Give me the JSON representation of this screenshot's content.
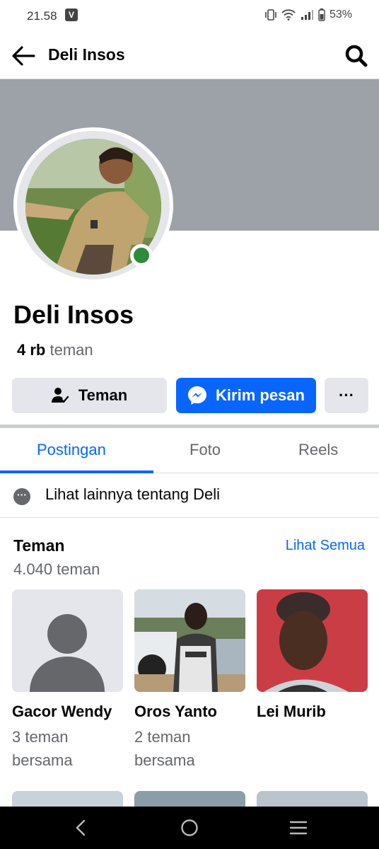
{
  "status_bar": {
    "time": "21.58",
    "v_badge": "V",
    "battery": "53%"
  },
  "header": {
    "title": "Deli Insos",
    "back_icon": "arrow-left-icon",
    "search_icon": "search-icon"
  },
  "profile": {
    "name": "Deli Insos",
    "friends_count_value": "4 rb",
    "friends_count_label": "teman",
    "online": true
  },
  "actions": {
    "friends_label": "Teman",
    "message_label": "Kirim pesan",
    "more_label": "···"
  },
  "tabs": [
    {
      "label": "Postingan",
      "active": true
    },
    {
      "label": "Foto",
      "active": false
    },
    {
      "label": "Reels",
      "active": false
    }
  ],
  "see_more": {
    "label": "Lihat lainnya tentang Deli"
  },
  "friends_section": {
    "title": "Teman",
    "see_all": "Lihat Semua",
    "count": "4.040 teman",
    "friends": [
      {
        "name": "Gacor Wendy",
        "mutual": "3 teman bersama"
      },
      {
        "name": "Oros Yanto",
        "mutual": "2 teman bersama"
      },
      {
        "name": "Lei Murib",
        "mutual": ""
      }
    ]
  },
  "colors": {
    "accent": "#0866ff",
    "online": "#2e8b3a",
    "cover": "#9da2a8"
  }
}
